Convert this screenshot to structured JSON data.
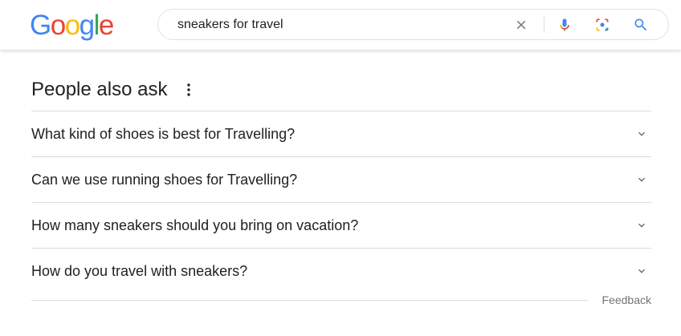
{
  "logo": {
    "letters": [
      "G",
      "o",
      "o",
      "g",
      "l",
      "e"
    ],
    "colors": [
      "#4285F4",
      "#EA4335",
      "#FBBC05",
      "#4285F4",
      "#34A853",
      "#EA4335"
    ]
  },
  "search": {
    "query": "sneakers for travel",
    "icons": [
      "clear-icon",
      "microphone-icon",
      "camera-lens-icon",
      "search-icon"
    ]
  },
  "people_also_ask": {
    "title": "People also ask",
    "more_icon": "more-vert-icon",
    "questions": [
      {
        "text": "What kind of shoes is best for Travelling?",
        "icon": "chevron-down-icon"
      },
      {
        "text": "Can we use running shoes for Travelling?",
        "icon": "chevron-down-icon"
      },
      {
        "text": "How many sneakers should you bring on vacation?",
        "icon": "chevron-down-icon"
      },
      {
        "text": "How do you travel with sneakers?",
        "icon": "chevron-down-icon"
      }
    ]
  },
  "feedback": {
    "label": "Feedback"
  },
  "colors": {
    "text_primary": "#202124",
    "text_secondary": "#70757a",
    "divider": "#dadce0",
    "search_blue": "#4285F4"
  }
}
